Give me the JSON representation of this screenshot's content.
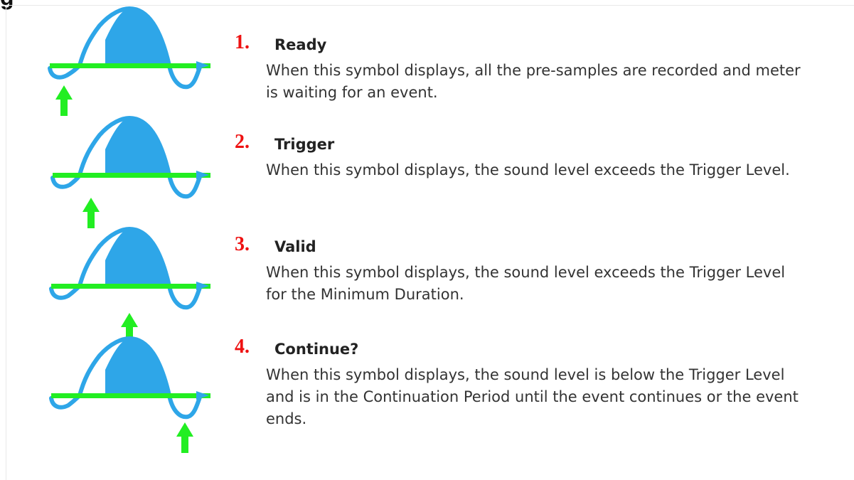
{
  "heading_fragment": "g",
  "colors": {
    "wave": "#2ea6e8",
    "baseline": "#22ee22",
    "arrow": "#22ee22",
    "number": "#ee1111"
  },
  "items": [
    {
      "number": "1.",
      "title": "Ready",
      "description": "When this symbol displays, all the pre-samples are recorded and meter is waiting for an event.",
      "icon": "ready-waveform-icon"
    },
    {
      "number": "2.",
      "title": "Trigger",
      "description": "When this symbol displays, the sound level exceeds the Trigger Level.",
      "icon": "trigger-waveform-icon"
    },
    {
      "number": "3.",
      "title": "Valid",
      "description": "When this symbol displays, the sound level exceeds the Trigger Level for the Minimum Duration.",
      "icon": "valid-waveform-icon"
    },
    {
      "number": "4.",
      "title": "Continue?",
      "description": "When this symbol displays, the sound level is below the Trigger Level and is in the Continuation Period until the event continues or the event ends.",
      "icon": "continue-waveform-icon"
    }
  ]
}
